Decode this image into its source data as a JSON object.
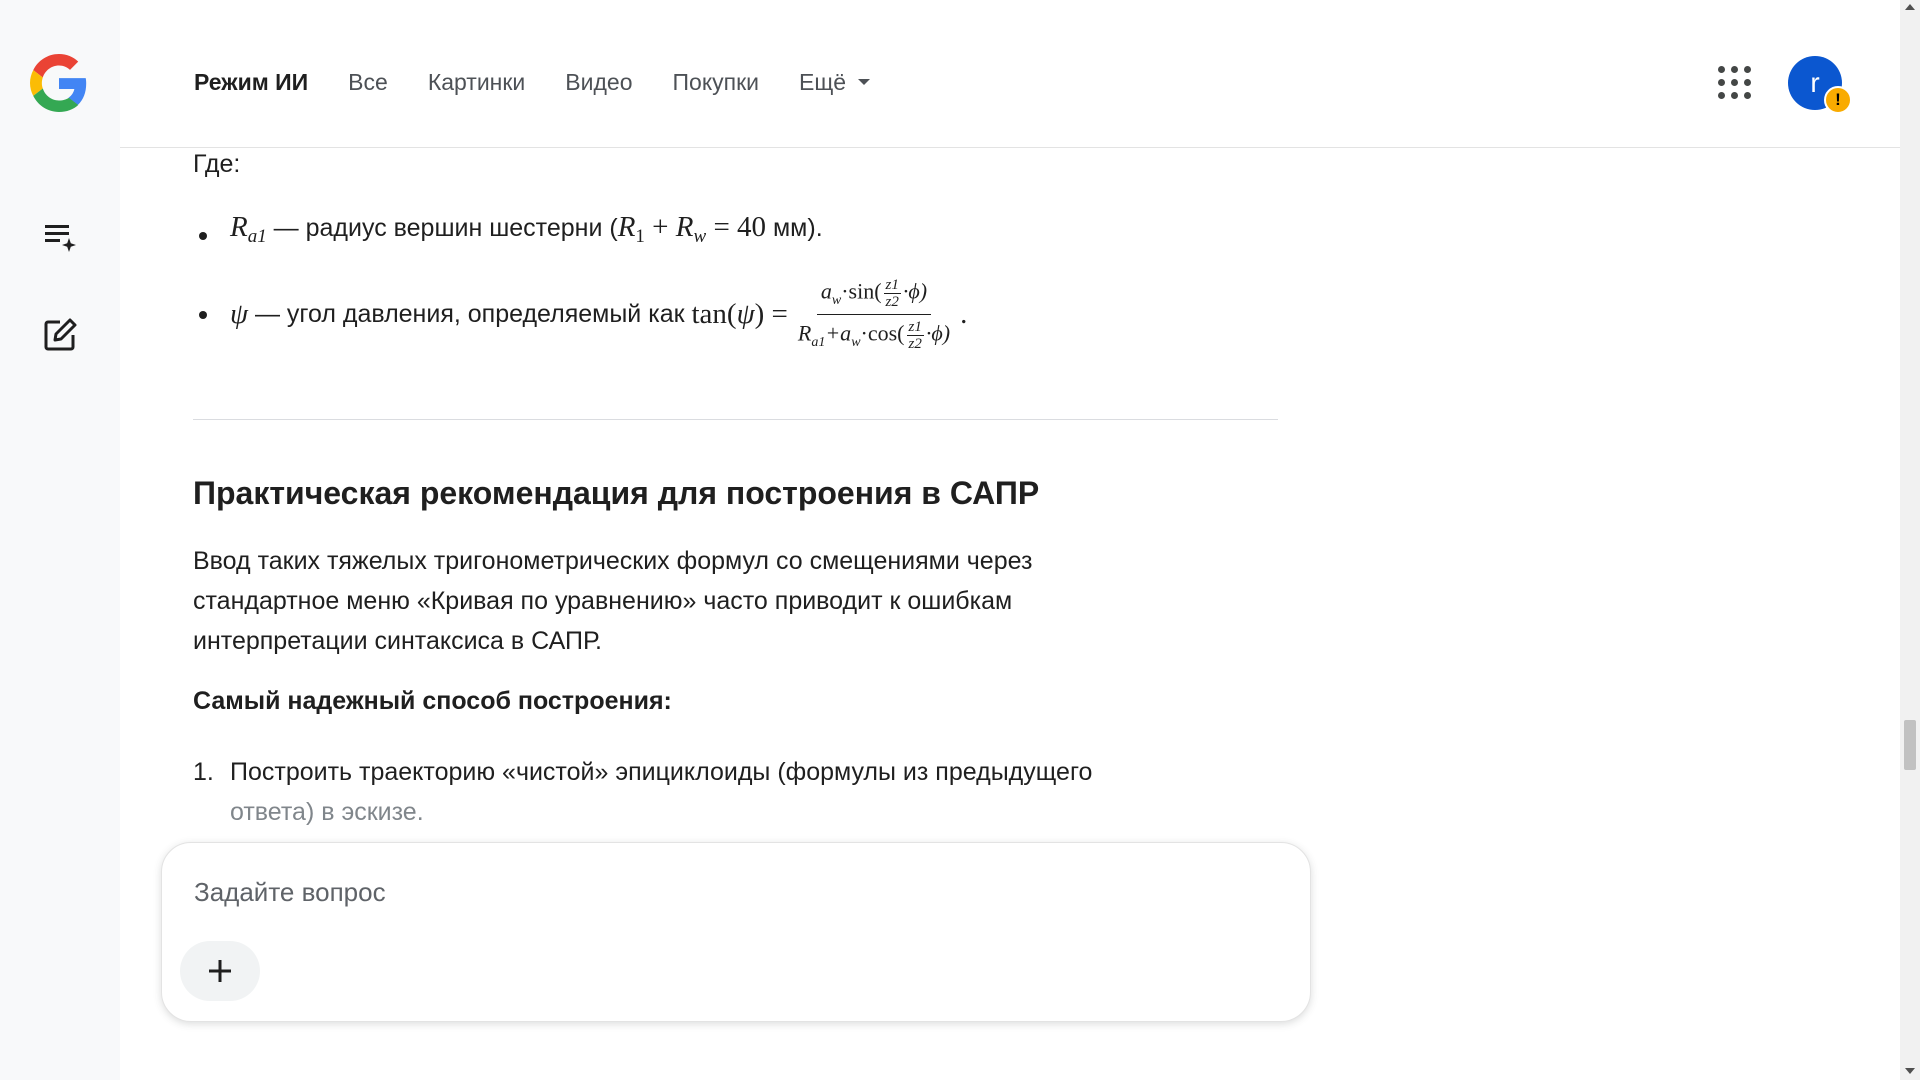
{
  "header": {
    "tabs": [
      {
        "label": "Режим ИИ",
        "active": true
      },
      {
        "label": "Все"
      },
      {
        "label": "Картинки"
      },
      {
        "label": "Видео"
      },
      {
        "label": "Покупки"
      },
      {
        "label": "Ещё"
      }
    ],
    "avatar_letter": "r",
    "avatar_badge": "!"
  },
  "content": {
    "where_label": "Где:",
    "bullet1": {
      "symbol": "R",
      "symbol_sub": "a1",
      "text": " — радиус вершин шестерни (",
      "expr_r1": "R",
      "expr_r1_sub": "1",
      "expr_plus": " + ",
      "expr_rw": "R",
      "expr_rw_sub": "w",
      "expr_eq": " = 40",
      "unit": " мм)."
    },
    "bullet2": {
      "symbol": "ψ",
      "text": " — угол давления, определяемый как ",
      "tan": "tan(",
      "psi": "ψ",
      "close": ") =",
      "num_a": "a",
      "num_a_sub": "w",
      "num_fn": "·sin(",
      "frac_n": "z1",
      "frac_d": "z2",
      "num_phi": "·ϕ)",
      "den_r": "R",
      "den_r_sub": "a1",
      "den_plus": "+a",
      "den_a_sub": "w",
      "den_fn": "·cos(",
      "den_phi": "·ϕ)",
      "end": "."
    },
    "heading": "Практическая рекомендация для построения в САПР",
    "paragraph": "Ввод таких тяжелых тригонометрических формул со смещениями через стандартное меню «Кривая по уравнению» часто приводит к ошибкам интерпретации синтаксиса в САПР.",
    "bold_line": "Самый надежный способ построения:",
    "list": [
      {
        "num": "1.",
        "text_main": "Построить траекторию «чистой» эпициклоиды (формулы из предыдущего",
        "text_fade": "ответа) в эскизе."
      }
    ]
  },
  "ask": {
    "placeholder": "Задайте вопрос"
  }
}
